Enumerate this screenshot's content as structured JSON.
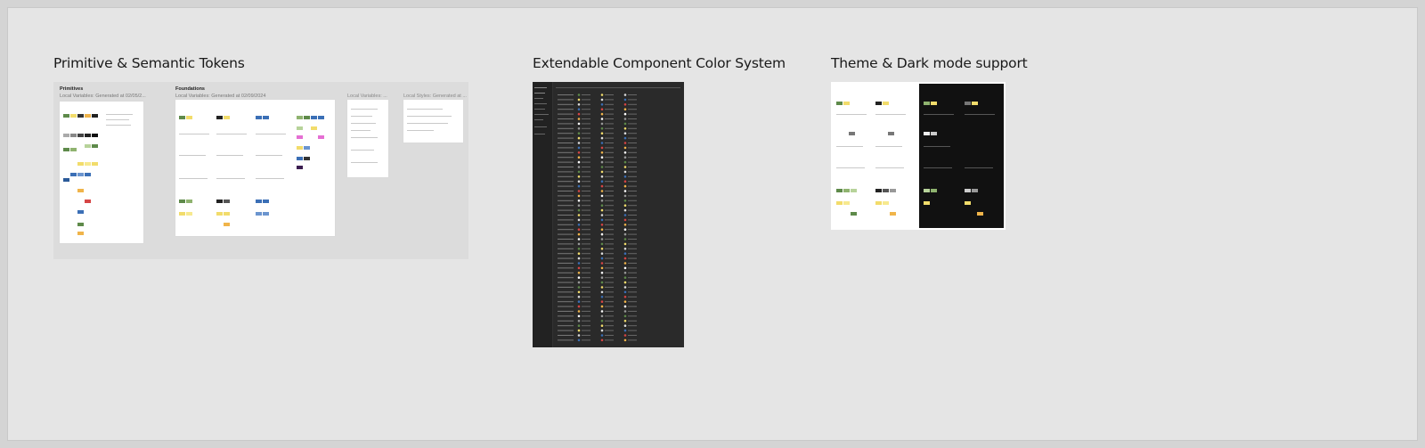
{
  "canvas": {
    "sections": [
      {
        "title": "Primitive & Semantic Tokens"
      },
      {
        "title": "Extendable Component Color System"
      },
      {
        "title": "Theme & Dark mode support"
      }
    ]
  },
  "tokens_panel": {
    "primitives": {
      "heading": "Primitives",
      "subtitle": "Local Variables: Generated at 02/05/2..."
    },
    "foundations": {
      "heading": "Foundations",
      "subtitle": "Local Variables: Generated at 02/09/2024"
    },
    "local_variables": {
      "subtitle": "Local Variables: ..."
    },
    "local_styles": {
      "subtitle": "Local Styles: Generated at ..."
    }
  },
  "colors": {
    "canvas_bg": "#e5e5e5",
    "panel_bg": "#dcdcdc",
    "dark_bg": "#2a2a2a",
    "swatch_green": "#5e8a4a",
    "swatch_yellow": "#f2dc6b",
    "swatch_blue": "#3b6fb6",
    "swatch_pink": "#e56fd3",
    "swatch_red": "#d64545",
    "swatch_orange": "#f0b44a"
  }
}
